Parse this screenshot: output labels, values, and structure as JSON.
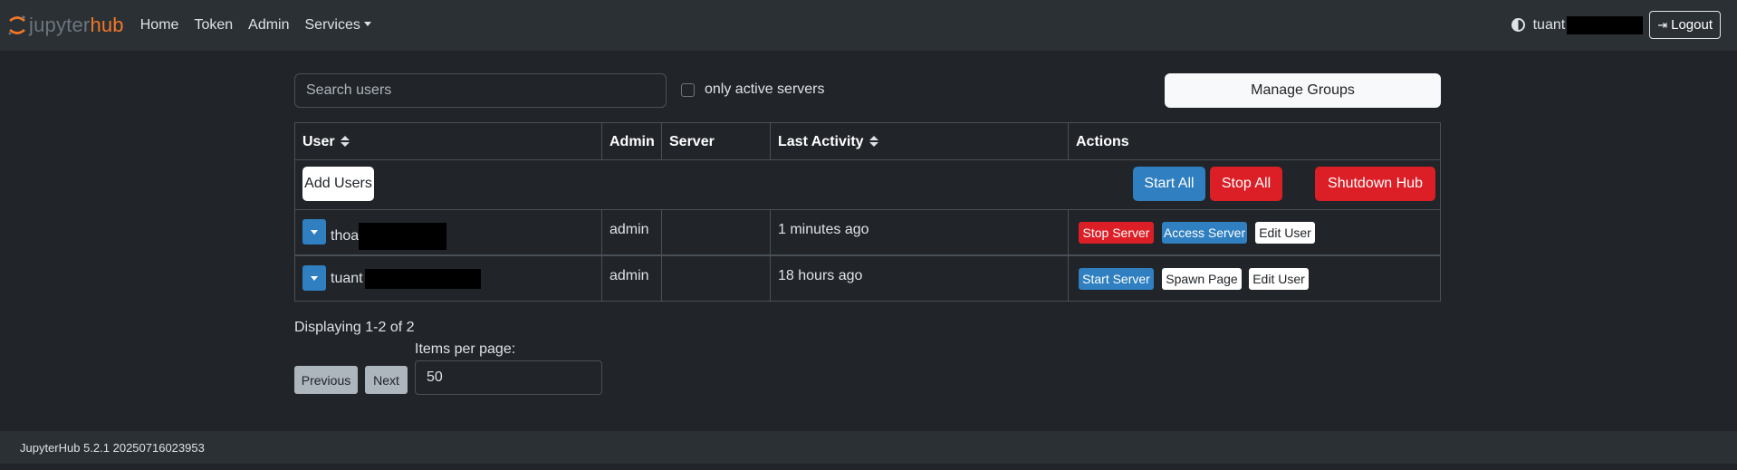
{
  "nav": {
    "logo_part1": "jupyter",
    "logo_part2": "hub",
    "links": [
      "Home",
      "Token",
      "Admin",
      "Services"
    ],
    "user": "tuant",
    "logout": "Logout"
  },
  "controls": {
    "search_placeholder": "Search users",
    "only_active_label": "only active servers",
    "manage_groups": "Manage Groups"
  },
  "table": {
    "headers": [
      "User",
      "Admin",
      "Server",
      "Last Activity",
      "Actions"
    ],
    "add_users": "Add Users",
    "start_all": "Start All",
    "stop_all": "Stop All",
    "shutdown_hub": "Shutdown Hub",
    "rows": [
      {
        "user": "thoa",
        "admin": "admin",
        "server": "",
        "last_activity": "1 minutes ago",
        "actions": [
          "Stop Server",
          "Access Server",
          "Edit User"
        ]
      },
      {
        "user": "tuant",
        "admin": "admin",
        "server": "",
        "last_activity": "18 hours ago",
        "actions": [
          "Start Server",
          "Spawn Page",
          "Edit User"
        ]
      }
    ]
  },
  "pagination": {
    "display": "Displaying 1-2 of 2",
    "previous": "Previous",
    "next": "Next",
    "items_per_page_label": "Items per page:",
    "items_per_page": "50"
  },
  "footer": {
    "version": "JupyterHub 5.2.1 20250716023953"
  },
  "colors": {
    "accent_orange": "#f37726",
    "primary_blue": "#2f7fc1",
    "danger_red": "#dc1f26",
    "bg": "#212529",
    "navbar_bg": "#2b3035"
  }
}
